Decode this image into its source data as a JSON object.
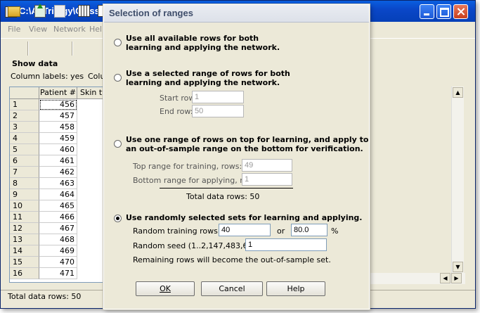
{
  "main_window": {
    "title": "C:\\AI Trilogy\\Classi",
    "menu": [
      "File",
      "View",
      "Network",
      "Help"
    ],
    "show_data_label": "Show data",
    "column_labels_text": "Column labels:  yes",
    "column_labels_text2": "Colu",
    "grid": {
      "headers": [
        "Patient #",
        "Skin ty"
      ],
      "rows": [
        {
          "n": "1",
          "v": "456"
        },
        {
          "n": "2",
          "v": "457"
        },
        {
          "n": "3",
          "v": "458"
        },
        {
          "n": "4",
          "v": "459"
        },
        {
          "n": "5",
          "v": "460"
        },
        {
          "n": "6",
          "v": "461"
        },
        {
          "n": "7",
          "v": "462"
        },
        {
          "n": "8",
          "v": "463"
        },
        {
          "n": "9",
          "v": "464"
        },
        {
          "n": "10",
          "v": "465"
        },
        {
          "n": "11",
          "v": "466"
        },
        {
          "n": "12",
          "v": "467"
        },
        {
          "n": "13",
          "v": "468"
        },
        {
          "n": "14",
          "v": "469"
        },
        {
          "n": "15",
          "v": "470"
        },
        {
          "n": "16",
          "v": "471"
        }
      ]
    },
    "status": "Total data rows: 50",
    "icons": [
      "folder-open-icon",
      "import-icon",
      "export-icon",
      "grid-icon",
      "grid-column-icon"
    ]
  },
  "dialog": {
    "title": "Selection of ranges",
    "option1": {
      "line1": "Use all available rows for both",
      "line2": "learning and applying the network."
    },
    "option2": {
      "line1": "Use a selected range of rows for both",
      "line2": "learning and applying the network.",
      "start_label": "Start row:",
      "start_value": "1",
      "end_label": "End row:",
      "end_value": "50"
    },
    "option3": {
      "line1": "Use one range of rows on top for learning, and apply to",
      "line2": "an out-of-sample range on the bottom for verification.",
      "top_label": "Top range for training, rows:",
      "top_value": "49",
      "bottom_label": "Bottom range for applying, rows:",
      "bottom_value": "1",
      "total_label": "Total data rows:  50"
    },
    "option4": {
      "line1": "Use randomly selected sets for learning and applying.",
      "train_label": "Random training rows:",
      "train_value": "40",
      "or_label": "or",
      "pct_value": "80.0",
      "pct_sign": "%",
      "seed_label": "Random seed (1..2,147,483,646):",
      "seed_value": "1",
      "remaining_note": "Remaining rows will become the out-of-sample set."
    },
    "selected_option": 4,
    "buttons": {
      "ok": "OK",
      "cancel": "Cancel",
      "help": "Help"
    }
  }
}
